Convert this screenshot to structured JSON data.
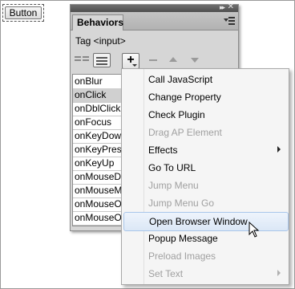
{
  "page": {
    "button_label": "Button"
  },
  "panel": {
    "tab_label": "Behaviors",
    "collapse_icon": "double-chevron-right-icon",
    "close_icon": "close-icon",
    "tag_label": "Tag <input>",
    "events": [
      "onBlur",
      "onClick",
      "onDblClick",
      "onFocus",
      "onKeyDown",
      "onKeyPress",
      "onKeyUp",
      "onMouseDown",
      "onMouseMove",
      "onMouseOut",
      "onMouseOver"
    ],
    "selected_event": "onClick",
    "add_button_label": "+"
  },
  "menu": {
    "items": [
      {
        "label": "Call JavaScript",
        "enabled": true
      },
      {
        "label": "Change Property",
        "enabled": true
      },
      {
        "label": "Check Plugin",
        "enabled": true
      },
      {
        "label": "Drag AP Element",
        "enabled": false
      },
      {
        "label": "Effects",
        "enabled": true,
        "submenu": true
      },
      {
        "label": "Go To URL",
        "enabled": true
      },
      {
        "label": "Jump Menu",
        "enabled": false
      },
      {
        "label": "Jump Menu Go",
        "enabled": false
      },
      {
        "label": "Open Browser Window",
        "enabled": true,
        "highlighted": true
      },
      {
        "label": "Popup Message",
        "enabled": true
      },
      {
        "label": "Preload Images",
        "enabled": false
      },
      {
        "label": "Set Text",
        "enabled": false,
        "submenu": true
      }
    ]
  },
  "colors": {
    "panel_bg": "#d6d6d6",
    "header_bg": "#5c5c5c",
    "highlight": "#dbe7f6",
    "disabled_text": "#a0a0a0"
  }
}
